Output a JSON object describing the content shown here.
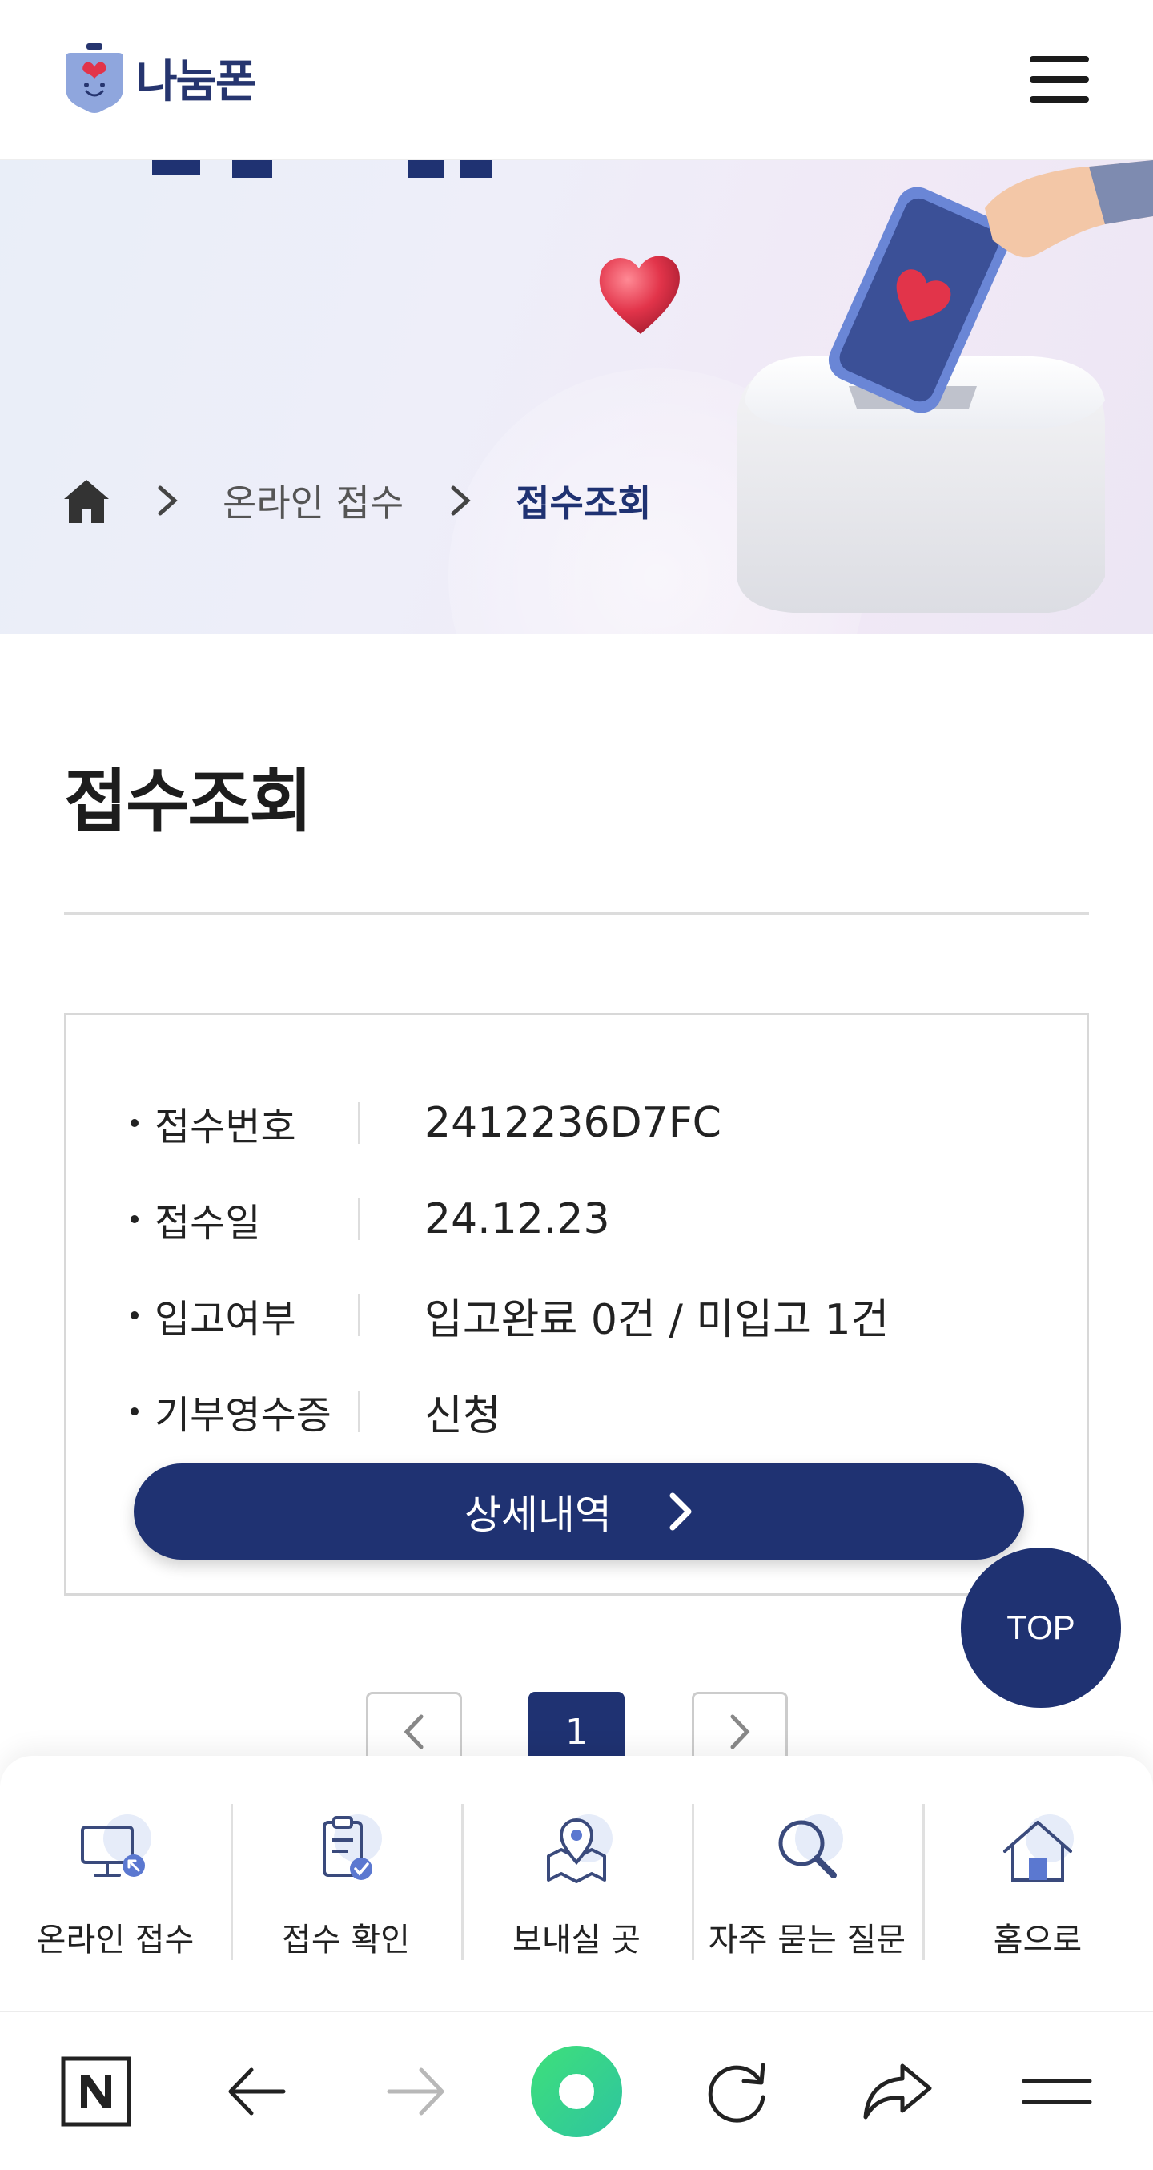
{
  "header": {
    "logo_text": "나눔폰"
  },
  "breadcrumb": {
    "items": [
      "온라인 접수"
    ],
    "current": "접수조회"
  },
  "page": {
    "title": "접수조회"
  },
  "receipt": {
    "rows": [
      {
        "label": "접수번호",
        "value": "2412236D7FC"
      },
      {
        "label": "접수일",
        "value": "24.12.23"
      },
      {
        "label": "입고여부",
        "value": "입고완료 0건 / 미입고 1건"
      },
      {
        "label": "기부영수증",
        "value": "신청"
      }
    ],
    "detail_button": "상세내역"
  },
  "top_button": "TOP",
  "pagination": {
    "current_page": "1"
  },
  "quicknav": [
    {
      "label": "온라인 접수",
      "icon": "computer-icon"
    },
    {
      "label": "접수 확인",
      "icon": "clipboard-check-icon"
    },
    {
      "label": "보내실 곳",
      "icon": "map-pin-icon"
    },
    {
      "label": "자주 묻는 질문",
      "icon": "search-icon"
    },
    {
      "label": "홈으로",
      "icon": "home-icon"
    }
  ],
  "browser_bar": [
    "naver-icon",
    "back-icon",
    "forward-icon",
    "green-dot-icon",
    "refresh-icon",
    "share-icon",
    "menu-icon"
  ],
  "colors": {
    "primary": "#1f3272",
    "accent_heart": "#e2344a",
    "icon_bg": "#e6ecf9"
  }
}
